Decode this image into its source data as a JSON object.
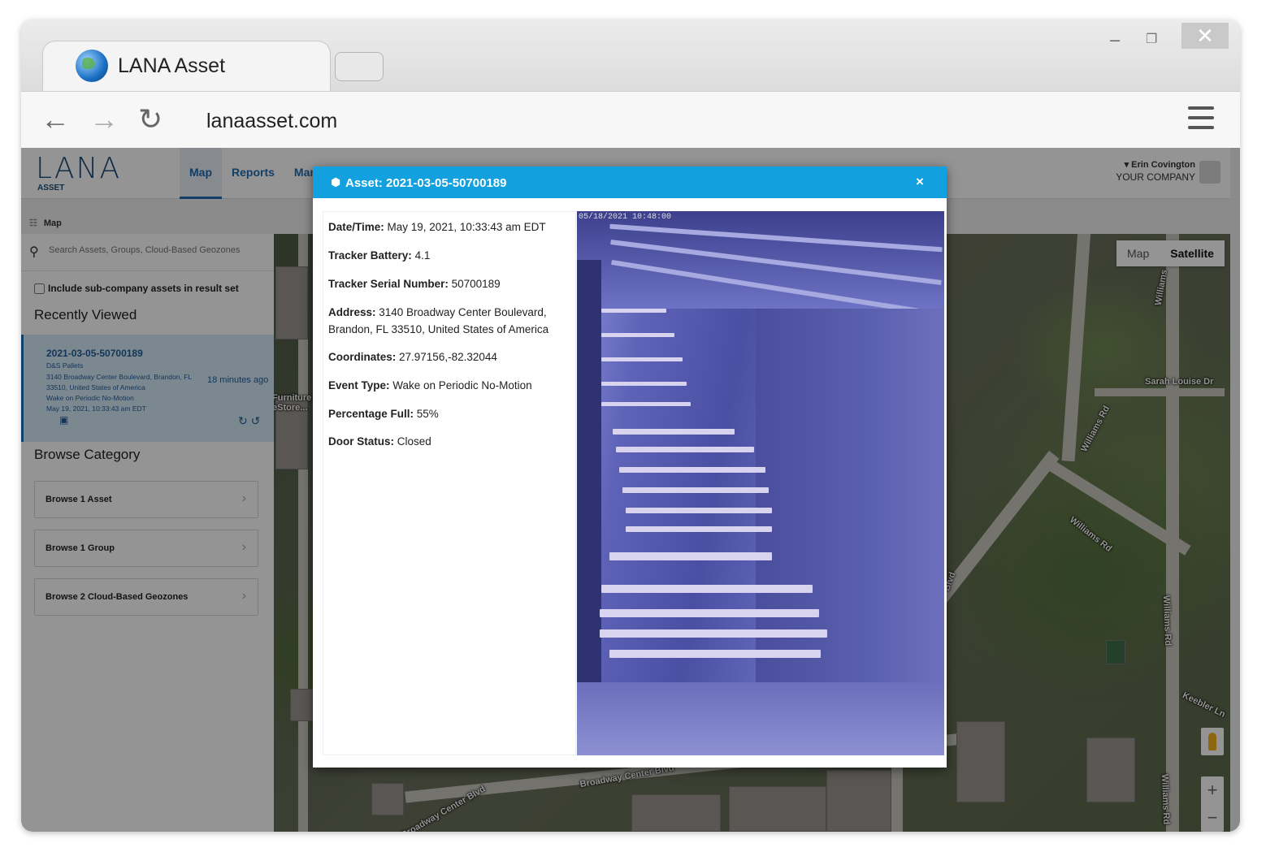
{
  "browser": {
    "tab_title": "LANA Asset",
    "url": "lanaasset.com",
    "window_controls": {
      "minimize": "–",
      "restore": "❐",
      "close": "✕"
    }
  },
  "app": {
    "logo_main": "LANA",
    "logo_sub": "ASSET",
    "nav": [
      "Map",
      "Reports",
      "Man"
    ],
    "user_name": "Erin Covington",
    "user_company": "YOUR COMPANY"
  },
  "breadcrumb": "Map",
  "sidebar": {
    "search_placeholder": "Search Assets, Groups, Cloud-Based Geozones",
    "include_subco": "Include sub-company assets in result set",
    "recently_viewed_title": "Recently Viewed",
    "recent_item": {
      "id": "2021-03-05-50700189",
      "lines": [
        "D&S Pallets",
        "3140 Broadway Center Boulevard, Brandon, FL",
        "33510, United States of America",
        "Wake on Periodic No-Motion",
        "May 19, 2021, 10:33:43 am EDT"
      ],
      "time_ago": "18 minutes ago"
    },
    "browse_title": "Browse Category",
    "browse_items": [
      "Browse 1 Asset",
      "Browse 1 Group",
      "Browse 2 Cloud-Based Geozones"
    ]
  },
  "map": {
    "toggle": [
      "Map",
      "Satellite"
    ],
    "selected_toggle": "Satellite",
    "labels": [
      "Sarah Louise Dr",
      "Williams Rd",
      "Williams Rd",
      "Williams Rd",
      "Williams Rd",
      "Keebler Ln",
      "Broadway Center Blvd",
      "Broadway Center Blvd",
      "Furniture",
      "eStore...",
      "Blvd",
      "Williams"
    ],
    "zoom": [
      "+",
      "−"
    ]
  },
  "modal": {
    "title": "Asset: 2021-03-05-50700189",
    "close": "×",
    "details": [
      {
        "label": "Date/Time:",
        "value": " May 19, 2021, 10:33:43 am EDT"
      },
      {
        "label": "Tracker Battery:",
        "value": " 4.1"
      },
      {
        "label": "Tracker Serial Number:",
        "value": " 50700189"
      },
      {
        "label": "Address:",
        "value": " 3140 Broadway Center Boulevard, Brandon, FL 33510, United States of America"
      },
      {
        "label": "Coordinates:",
        "value": " 27.97156,-82.32044"
      },
      {
        "label": "Event Type:",
        "value": " Wake on Periodic No-Motion"
      },
      {
        "label": "Percentage Full:",
        "value": " 55%"
      },
      {
        "label": "Door Status:",
        "value": " Closed"
      }
    ],
    "photo_timestamp": "05/18/2021 10:48:00"
  }
}
